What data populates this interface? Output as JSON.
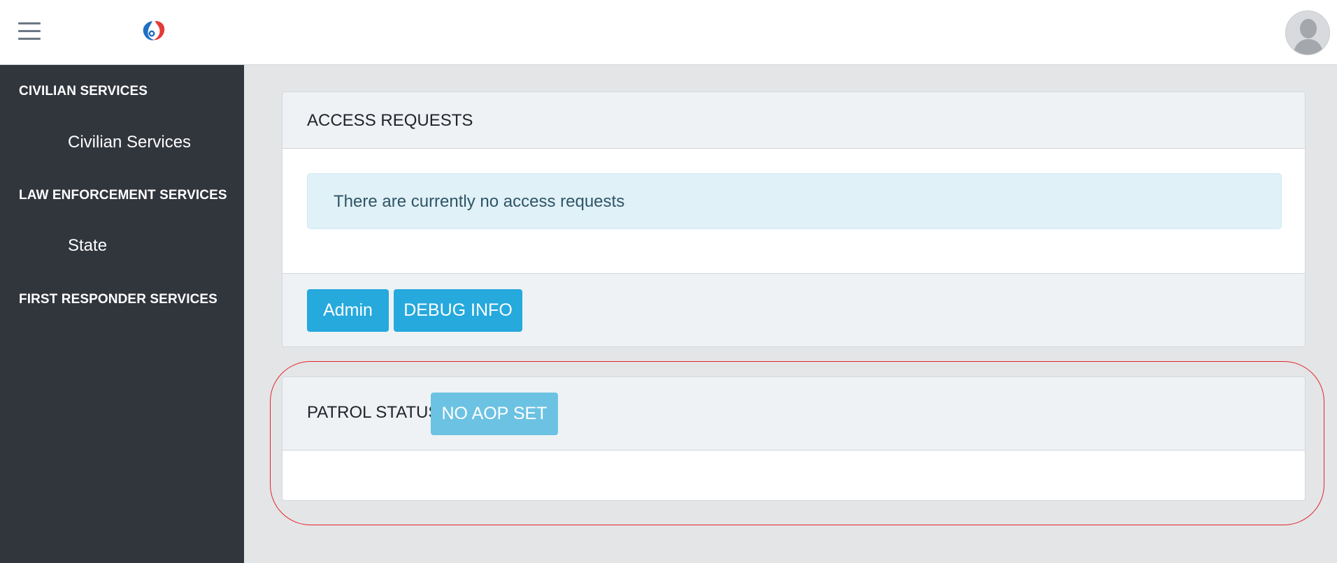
{
  "navbar": {
    "menu_icon": "hamburger-menu-icon",
    "logo_icon": "swirl-logo-icon",
    "avatar_icon": "user-avatar-icon",
    "colors": {
      "logo_blue": "#1f6fc5",
      "logo_red": "#e33a3a"
    }
  },
  "sidebar": {
    "sections": [
      {
        "title": "CIVILIAN SERVICES",
        "items": [
          "Civilian Services"
        ]
      },
      {
        "title": "LAW ENFORCEMENT SERVICES",
        "items": [
          "State"
        ]
      },
      {
        "title": "FIRST RESPONDER SERVICES",
        "items": []
      }
    ]
  },
  "access_requests": {
    "title": "ACCESS REQUESTS",
    "message": "There are currently no access requests",
    "buttons": {
      "admin": "Admin",
      "debug": "DEBUG INFO"
    }
  },
  "patrol_status": {
    "title": "PATROL STATUS",
    "aop_badge": "NO AOP SET"
  },
  "colors": {
    "sidebar_bg": "#31353c",
    "primary_button": "#26a9dd",
    "info_alert_bg": "#e0f1f7",
    "highlight_outline": "#e1262b"
  }
}
